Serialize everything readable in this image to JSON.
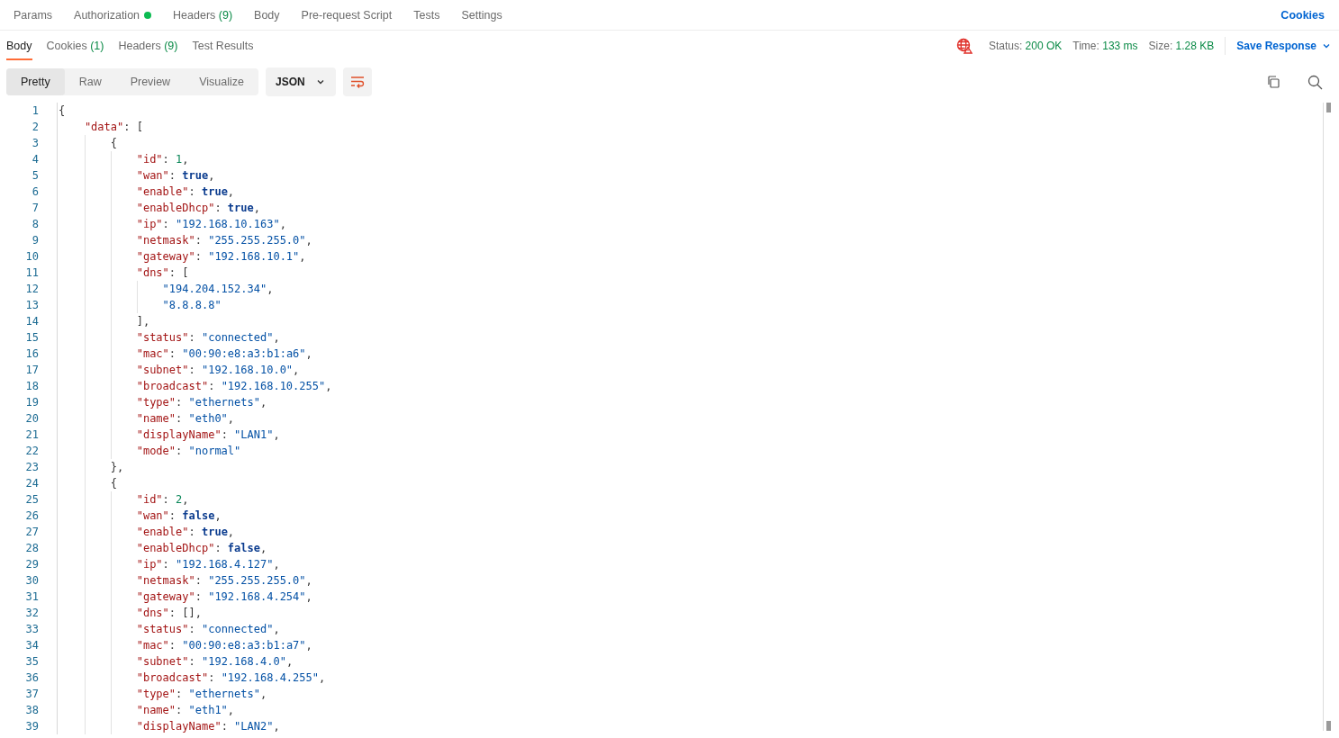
{
  "request_tabs": [
    {
      "label": "Params",
      "dot": false
    },
    {
      "label": "Authorization",
      "dot": true
    },
    {
      "label": "Headers",
      "count": "(9)",
      "dot": false
    },
    {
      "label": "Body",
      "dot": false
    },
    {
      "label": "Pre-request Script",
      "dot": false
    },
    {
      "label": "Tests",
      "dot": false
    },
    {
      "label": "Settings",
      "dot": false
    }
  ],
  "cookies_link": "Cookies",
  "response_tabs": [
    {
      "label": "Body",
      "selected": true
    },
    {
      "label": "Cookies",
      "count": "(1)",
      "selected": false
    },
    {
      "label": "Headers",
      "count": "(9)",
      "selected": false
    },
    {
      "label": "Test Results",
      "selected": false
    }
  ],
  "status": [
    {
      "label": "Status:",
      "value": "200 OK"
    },
    {
      "label": "Time:",
      "value": "133 ms"
    },
    {
      "label": "Size:",
      "value": "1.28 KB"
    }
  ],
  "save_response": "Save Response",
  "view_modes": [
    {
      "label": "Pretty",
      "selected": true
    },
    {
      "label": "Raw",
      "selected": false
    },
    {
      "label": "Preview",
      "selected": false
    },
    {
      "label": "Visualize",
      "selected": false
    }
  ],
  "format": "JSON",
  "code_lines": [
    {
      "number": "1",
      "tokens": [
        {
          "kind": "punct",
          "text": "{"
        }
      ]
    },
    {
      "number": "2",
      "tokens": [
        {
          "kind": "key",
          "text": "    \"data\""
        },
        {
          "kind": "punct",
          "text": ": ["
        }
      ]
    },
    {
      "number": "3",
      "tokens": [
        {
          "kind": "punct",
          "text": "        {"
        }
      ]
    },
    {
      "number": "4",
      "tokens": [
        {
          "kind": "key",
          "text": "            \"id\""
        },
        {
          "kind": "punct",
          "text": ": "
        },
        {
          "kind": "number",
          "text": "1"
        },
        {
          "kind": "punct",
          "text": ","
        }
      ]
    },
    {
      "number": "5",
      "tokens": [
        {
          "kind": "key",
          "text": "            \"wan\""
        },
        {
          "kind": "punct",
          "text": ": "
        },
        {
          "kind": "bool",
          "text": "true"
        },
        {
          "kind": "punct",
          "text": ","
        }
      ]
    },
    {
      "number": "6",
      "tokens": [
        {
          "kind": "key",
          "text": "            \"enable\""
        },
        {
          "kind": "punct",
          "text": ": "
        },
        {
          "kind": "bool",
          "text": "true"
        },
        {
          "kind": "punct",
          "text": ","
        }
      ]
    },
    {
      "number": "7",
      "tokens": [
        {
          "kind": "key",
          "text": "            \"enableDhcp\""
        },
        {
          "kind": "punct",
          "text": ": "
        },
        {
          "kind": "bool",
          "text": "true"
        },
        {
          "kind": "punct",
          "text": ","
        }
      ]
    },
    {
      "number": "8",
      "tokens": [
        {
          "kind": "key",
          "text": "            \"ip\""
        },
        {
          "kind": "punct",
          "text": ": "
        },
        {
          "kind": "string",
          "text": "\"192.168.10.163\""
        },
        {
          "kind": "punct",
          "text": ","
        }
      ]
    },
    {
      "number": "9",
      "tokens": [
        {
          "kind": "key",
          "text": "            \"netmask\""
        },
        {
          "kind": "punct",
          "text": ": "
        },
        {
          "kind": "string",
          "text": "\"255.255.255.0\""
        },
        {
          "kind": "punct",
          "text": ","
        }
      ]
    },
    {
      "number": "10",
      "tokens": [
        {
          "kind": "key",
          "text": "            \"gateway\""
        },
        {
          "kind": "punct",
          "text": ": "
        },
        {
          "kind": "string",
          "text": "\"192.168.10.1\""
        },
        {
          "kind": "punct",
          "text": ","
        }
      ]
    },
    {
      "number": "11",
      "tokens": [
        {
          "kind": "key",
          "text": "            \"dns\""
        },
        {
          "kind": "punct",
          "text": ": ["
        }
      ]
    },
    {
      "number": "12",
      "tokens": [
        {
          "kind": "string",
          "text": "                \"194.204.152.34\""
        },
        {
          "kind": "punct",
          "text": ","
        }
      ]
    },
    {
      "number": "13",
      "tokens": [
        {
          "kind": "string",
          "text": "                \"8.8.8.8\""
        }
      ]
    },
    {
      "number": "14",
      "tokens": [
        {
          "kind": "punct",
          "text": "            ],"
        }
      ]
    },
    {
      "number": "15",
      "tokens": [
        {
          "kind": "key",
          "text": "            \"status\""
        },
        {
          "kind": "punct",
          "text": ": "
        },
        {
          "kind": "string",
          "text": "\"connected\""
        },
        {
          "kind": "punct",
          "text": ","
        }
      ]
    },
    {
      "number": "16",
      "tokens": [
        {
          "kind": "key",
          "text": "            \"mac\""
        },
        {
          "kind": "punct",
          "text": ": "
        },
        {
          "kind": "string",
          "text": "\"00:90:e8:a3:b1:a6\""
        },
        {
          "kind": "punct",
          "text": ","
        }
      ]
    },
    {
      "number": "17",
      "tokens": [
        {
          "kind": "key",
          "text": "            \"subnet\""
        },
        {
          "kind": "punct",
          "text": ": "
        },
        {
          "kind": "string",
          "text": "\"192.168.10.0\""
        },
        {
          "kind": "punct",
          "text": ","
        }
      ]
    },
    {
      "number": "18",
      "tokens": [
        {
          "kind": "key",
          "text": "            \"broadcast\""
        },
        {
          "kind": "punct",
          "text": ": "
        },
        {
          "kind": "string",
          "text": "\"192.168.10.255\""
        },
        {
          "kind": "punct",
          "text": ","
        }
      ]
    },
    {
      "number": "19",
      "tokens": [
        {
          "kind": "key",
          "text": "            \"type\""
        },
        {
          "kind": "punct",
          "text": ": "
        },
        {
          "kind": "string",
          "text": "\"ethernets\""
        },
        {
          "kind": "punct",
          "text": ","
        }
      ]
    },
    {
      "number": "20",
      "tokens": [
        {
          "kind": "key",
          "text": "            \"name\""
        },
        {
          "kind": "punct",
          "text": ": "
        },
        {
          "kind": "string",
          "text": "\"eth0\""
        },
        {
          "kind": "punct",
          "text": ","
        }
      ]
    },
    {
      "number": "21",
      "tokens": [
        {
          "kind": "key",
          "text": "            \"displayName\""
        },
        {
          "kind": "punct",
          "text": ": "
        },
        {
          "kind": "string",
          "text": "\"LAN1\""
        },
        {
          "kind": "punct",
          "text": ","
        }
      ]
    },
    {
      "number": "22",
      "tokens": [
        {
          "kind": "key",
          "text": "            \"mode\""
        },
        {
          "kind": "punct",
          "text": ": "
        },
        {
          "kind": "string",
          "text": "\"normal\""
        }
      ]
    },
    {
      "number": "23",
      "tokens": [
        {
          "kind": "punct",
          "text": "        },"
        }
      ]
    },
    {
      "number": "24",
      "tokens": [
        {
          "kind": "punct",
          "text": "        {"
        }
      ]
    },
    {
      "number": "25",
      "tokens": [
        {
          "kind": "key",
          "text": "            \"id\""
        },
        {
          "kind": "punct",
          "text": ": "
        },
        {
          "kind": "number",
          "text": "2"
        },
        {
          "kind": "punct",
          "text": ","
        }
      ]
    },
    {
      "number": "26",
      "tokens": [
        {
          "kind": "key",
          "text": "            \"wan\""
        },
        {
          "kind": "punct",
          "text": ": "
        },
        {
          "kind": "bool",
          "text": "false"
        },
        {
          "kind": "punct",
          "text": ","
        }
      ]
    },
    {
      "number": "27",
      "tokens": [
        {
          "kind": "key",
          "text": "            \"enable\""
        },
        {
          "kind": "punct",
          "text": ": "
        },
        {
          "kind": "bool",
          "text": "true"
        },
        {
          "kind": "punct",
          "text": ","
        }
      ]
    },
    {
      "number": "28",
      "tokens": [
        {
          "kind": "key",
          "text": "            \"enableDhcp\""
        },
        {
          "kind": "punct",
          "text": ": "
        },
        {
          "kind": "bool",
          "text": "false"
        },
        {
          "kind": "punct",
          "text": ","
        }
      ]
    },
    {
      "number": "29",
      "tokens": [
        {
          "kind": "key",
          "text": "            \"ip\""
        },
        {
          "kind": "punct",
          "text": ": "
        },
        {
          "kind": "string",
          "text": "\"192.168.4.127\""
        },
        {
          "kind": "punct",
          "text": ","
        }
      ]
    },
    {
      "number": "30",
      "tokens": [
        {
          "kind": "key",
          "text": "            \"netmask\""
        },
        {
          "kind": "punct",
          "text": ": "
        },
        {
          "kind": "string",
          "text": "\"255.255.255.0\""
        },
        {
          "kind": "punct",
          "text": ","
        }
      ]
    },
    {
      "number": "31",
      "tokens": [
        {
          "kind": "key",
          "text": "            \"gateway\""
        },
        {
          "kind": "punct",
          "text": ": "
        },
        {
          "kind": "string",
          "text": "\"192.168.4.254\""
        },
        {
          "kind": "punct",
          "text": ","
        }
      ]
    },
    {
      "number": "32",
      "tokens": [
        {
          "kind": "key",
          "text": "            \"dns\""
        },
        {
          "kind": "punct",
          "text": ": [],"
        }
      ]
    },
    {
      "number": "33",
      "tokens": [
        {
          "kind": "key",
          "text": "            \"status\""
        },
        {
          "kind": "punct",
          "text": ": "
        },
        {
          "kind": "string",
          "text": "\"connected\""
        },
        {
          "kind": "punct",
          "text": ","
        }
      ]
    },
    {
      "number": "34",
      "tokens": [
        {
          "kind": "key",
          "text": "            \"mac\""
        },
        {
          "kind": "punct",
          "text": ": "
        },
        {
          "kind": "string",
          "text": "\"00:90:e8:a3:b1:a7\""
        },
        {
          "kind": "punct",
          "text": ","
        }
      ]
    },
    {
      "number": "35",
      "tokens": [
        {
          "kind": "key",
          "text": "            \"subnet\""
        },
        {
          "kind": "punct",
          "text": ": "
        },
        {
          "kind": "string",
          "text": "\"192.168.4.0\""
        },
        {
          "kind": "punct",
          "text": ","
        }
      ]
    },
    {
      "number": "36",
      "tokens": [
        {
          "kind": "key",
          "text": "            \"broadcast\""
        },
        {
          "kind": "punct",
          "text": ": "
        },
        {
          "kind": "string",
          "text": "\"192.168.4.255\""
        },
        {
          "kind": "punct",
          "text": ","
        }
      ]
    },
    {
      "number": "37",
      "tokens": [
        {
          "kind": "key",
          "text": "            \"type\""
        },
        {
          "kind": "punct",
          "text": ": "
        },
        {
          "kind": "string",
          "text": "\"ethernets\""
        },
        {
          "kind": "punct",
          "text": ","
        }
      ]
    },
    {
      "number": "38",
      "tokens": [
        {
          "kind": "key",
          "text": "            \"name\""
        },
        {
          "kind": "punct",
          "text": ": "
        },
        {
          "kind": "string",
          "text": "\"eth1\""
        },
        {
          "kind": "punct",
          "text": ","
        }
      ]
    },
    {
      "number": "39",
      "tokens": [
        {
          "kind": "key",
          "text": "            \"displayName\""
        },
        {
          "kind": "punct",
          "text": ": "
        },
        {
          "kind": "string",
          "text": "\"LAN2\""
        },
        {
          "kind": "punct",
          "text": ","
        }
      ]
    }
  ]
}
